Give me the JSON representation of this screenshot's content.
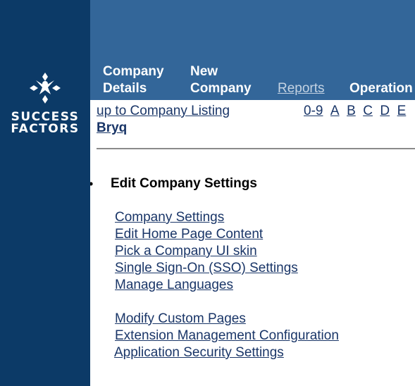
{
  "brand": {
    "line1": "SUCCESS",
    "line2": "FACTORS"
  },
  "nav": [
    {
      "line1": "Company",
      "line2": "Details"
    },
    {
      "line1": "New",
      "line2": "Company"
    },
    {
      "label": "Reports"
    },
    {
      "label": "Operation"
    }
  ],
  "content": {
    "up_link": "up to Company Listing",
    "alphabet": [
      "0-9",
      "A",
      "B",
      "C",
      "D",
      "E"
    ],
    "company_name": "Bryq",
    "section_title": "Edit Company Settings",
    "links_group1": [
      "Company Settings",
      "Edit Home Page Content",
      "Pick a Company UI skin",
      "Single Sign-On (SSO) Settings",
      "Manage Languages"
    ],
    "links_group2": [
      "Modify Custom Pages",
      "Extension Management Configuration",
      "Application Security Settings"
    ]
  },
  "colors": {
    "sidebar": "#0c3a67",
    "topbar": "#336699",
    "link": "#1a3668"
  }
}
